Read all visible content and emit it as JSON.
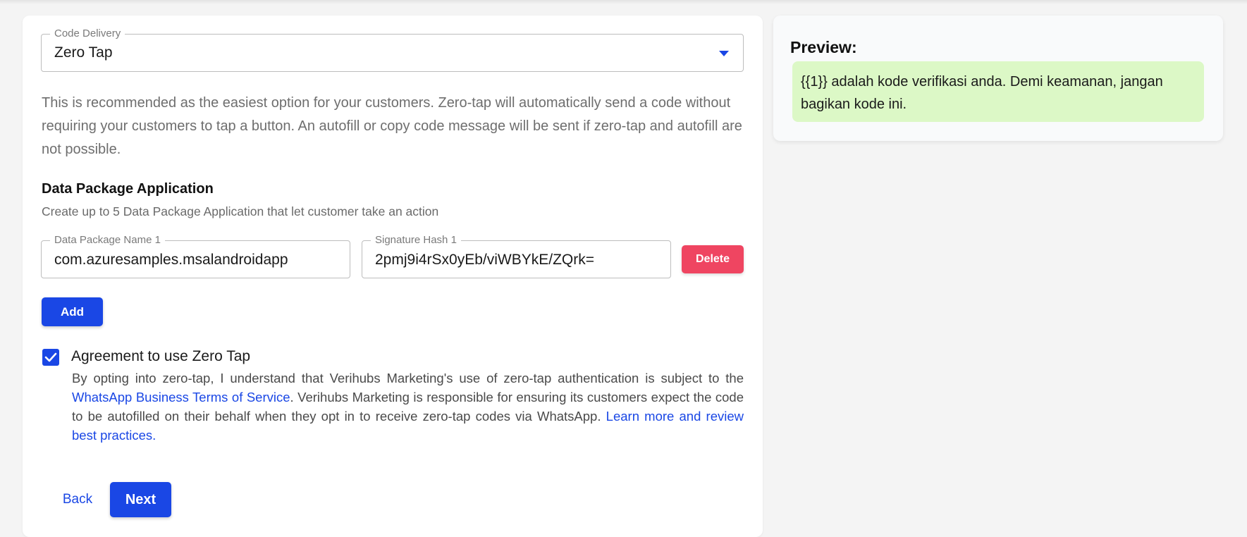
{
  "code_delivery": {
    "label": "Code Delivery",
    "value": "Zero Tap",
    "description": "This is recommended as the easiest option for your customers. Zero-tap will automatically send a code without requiring your customers to tap a button. An autofill or copy code message will be sent if zero-tap and autofill are not possible."
  },
  "data_package": {
    "title": "Data Package Application",
    "subtitle": "Create up to 5 Data Package Application that let customer take an action",
    "entries": [
      {
        "name_label": "Data Package Name 1",
        "name_value": "com.azuresamples.msalandroidapp",
        "hash_label": "Signature Hash 1",
        "hash_value": "2pmj9i4rSx0yEb/viWBYkE/ZQrk=",
        "delete_label": "Delete"
      }
    ],
    "add_label": "Add"
  },
  "agreement": {
    "checked": true,
    "label": "Agreement to use Zero Tap",
    "text_before_link": "By opting into zero-tap, I understand that Verihubs Marketing's use of zero-tap authentication is subject to the ",
    "terms_link": "WhatsApp Business Terms of Service",
    "text_after_link": ". Verihubs Marketing is responsible for ensuring its customers expect the code to be autofilled on their behalf when they opt in to receive zero-tap codes via WhatsApp. ",
    "learn_more_link": "Learn more and review best practices."
  },
  "footer": {
    "back_label": "Back",
    "next_label": "Next"
  },
  "preview": {
    "title": "Preview:",
    "message": "{{1}} adalah kode verifikasi anda. Demi keamanan, jangan bagikan kode ini."
  },
  "colors": {
    "primary": "#1a47e5",
    "danger": "#ef4561",
    "preview_bubble": "#dcf8c6"
  }
}
